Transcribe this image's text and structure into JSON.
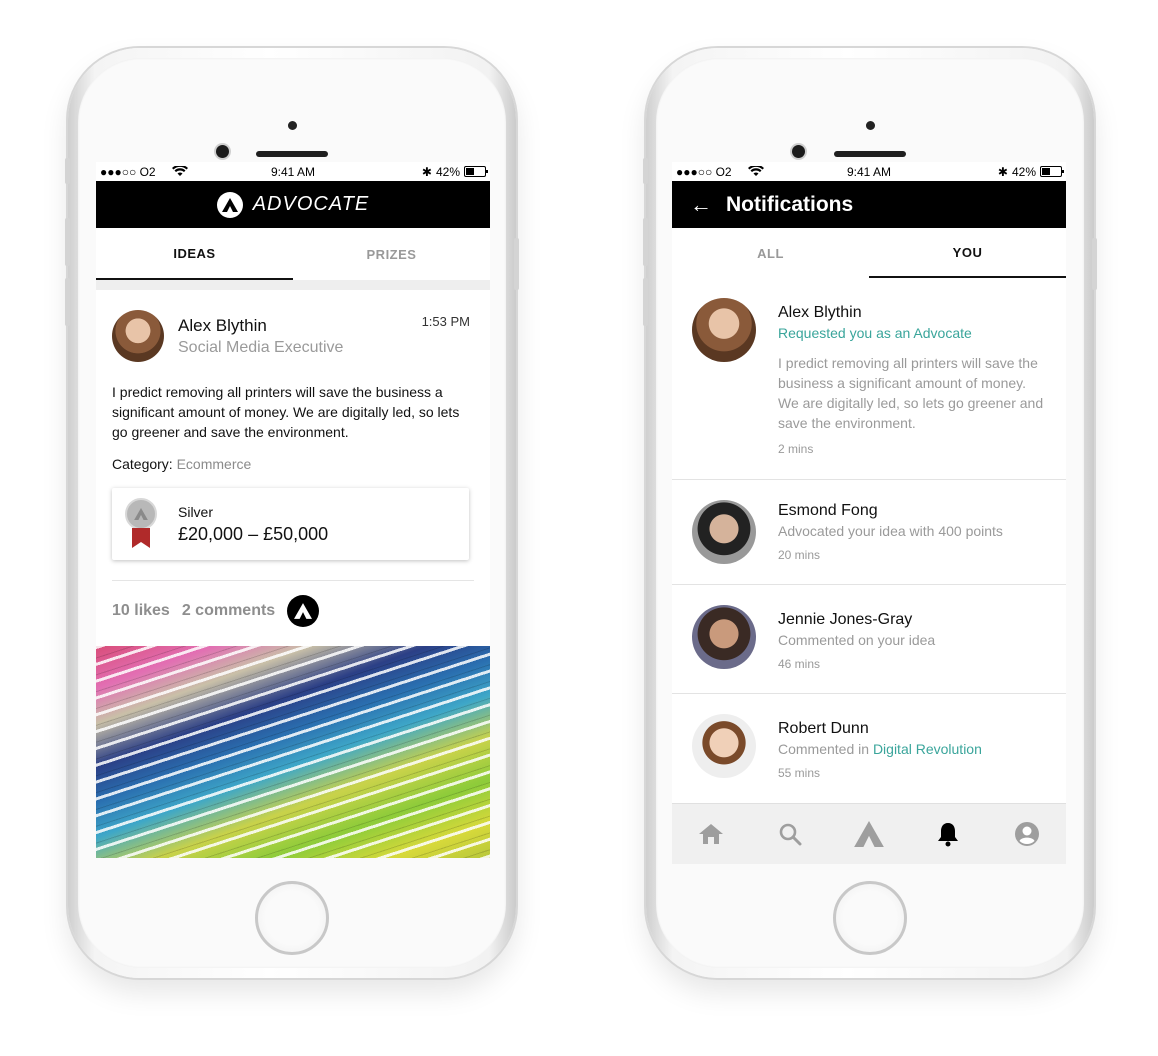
{
  "status_bar": {
    "carrier": "●●●○○ O2",
    "time": "9:41 AM",
    "battery": "42%"
  },
  "left_phone": {
    "brand": "ADVOCATE",
    "tabs": [
      {
        "label": "IDEAS",
        "active": true
      },
      {
        "label": "PRIZES",
        "active": false
      }
    ],
    "post": {
      "author_name": "Alex Blythin",
      "author_role": "Social Media Executive",
      "time": "1:53 PM",
      "body": "I predict removing all printers will save the business a significant amount of money. We are digitally led, so lets go greener and save the environment.",
      "category_label": "Category:",
      "category_value": "Ecommerce",
      "prize_tier": "Silver",
      "prize_range": "£20,000 – £50,000",
      "likes": "10 likes",
      "comments": "2 comments"
    }
  },
  "right_phone": {
    "title": "Notifications",
    "tabs": [
      {
        "label": "ALL",
        "active": false
      },
      {
        "label": "YOU",
        "active": true
      }
    ],
    "notifications": [
      {
        "name": "Alex Blythin",
        "action": "Requested you as an Advocate",
        "text": "I predict removing all printers will save the business a significant amount of money. We are digitally led, so lets go greener and save the environment.",
        "time": "2 mins"
      },
      {
        "name": "Esmond Fong",
        "action": "Advocated your idea with 400 points",
        "time": "20 mins"
      },
      {
        "name": "Jennie Jones-Gray",
        "action": "Commented on your idea",
        "time": "46 mins"
      },
      {
        "name": "Robert Dunn",
        "action_prefix": "Commented in",
        "action_link": "Digital Revolution",
        "time": "55 mins"
      }
    ],
    "bottom_nav": [
      {
        "icon": "home-icon",
        "active": false
      },
      {
        "icon": "search-icon",
        "active": false
      },
      {
        "icon": "advocate-logo-icon",
        "active": false
      },
      {
        "icon": "bell-icon",
        "active": true
      },
      {
        "icon": "profile-icon",
        "active": false
      }
    ]
  },
  "colors": {
    "accent_teal": "#3aa59b",
    "header_black": "#000000",
    "muted_gray": "#9a9a9a",
    "medal_red": "#b02a2a"
  }
}
